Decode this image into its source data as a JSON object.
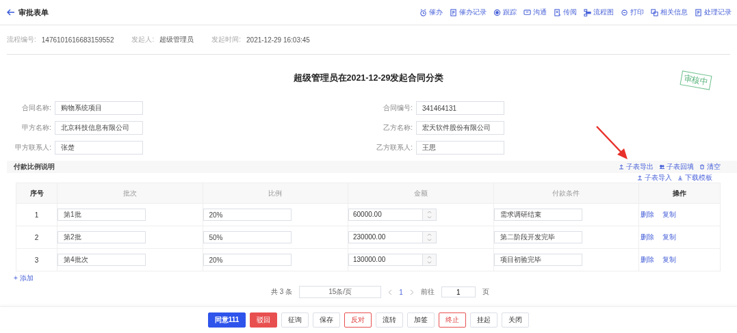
{
  "header": {
    "title": "审批表单",
    "actions": [
      {
        "label": "催办",
        "kind": "clock"
      },
      {
        "label": "催办记录",
        "kind": "doc"
      },
      {
        "label": "跟踪",
        "kind": "target"
      },
      {
        "label": "沟通",
        "kind": "chat"
      },
      {
        "label": "传阅",
        "kind": "list"
      },
      {
        "label": "流程图",
        "kind": "flow"
      },
      {
        "label": "打印",
        "kind": "print"
      },
      {
        "label": "相关信息",
        "kind": "copy"
      },
      {
        "label": "处理记录",
        "kind": "doc"
      }
    ]
  },
  "meta": [
    {
      "label": "流程编号:",
      "value": "1476101616683159552"
    },
    {
      "label": "发起人:",
      "value": "超级管理员"
    },
    {
      "label": "发起时间:",
      "value": "2021-12-29 16:03:45"
    }
  ],
  "form": {
    "title": "超级管理员在2021-12-29发起合同分类",
    "stamp": "审核中",
    "fields": [
      {
        "label": "合同名称:",
        "value": "购物系统项目"
      },
      {
        "label": "合同编号:",
        "value": "341464131"
      },
      {
        "label": "甲方名称:",
        "value": "北京科技信息有限公司"
      },
      {
        "label": "乙方名称:",
        "value": "宏天软件股份有限公司"
      },
      {
        "label": "甲方联系人:",
        "value": "张楚"
      },
      {
        "label": "乙方联系人:",
        "value": "王思"
      }
    ]
  },
  "subtable": {
    "title": "付款比例说明",
    "tools": [
      {
        "label": "子表导出",
        "kind": "export"
      },
      {
        "label": "子表回填",
        "kind": "people"
      },
      {
        "label": "清空",
        "kind": "trash"
      }
    ],
    "tools2": [
      {
        "label": "子表导入",
        "kind": "import"
      },
      {
        "label": "下载模板",
        "kind": "download"
      }
    ],
    "columns": [
      "序号",
      "批次",
      "比例",
      "金额",
      "付款条件",
      "操作"
    ],
    "rows": [
      {
        "index": "1",
        "batch": "第1批",
        "ratio": "20%",
        "amount": "60000.00",
        "condition": "需求调研结束",
        "ops": [
          "删除",
          "复制"
        ]
      },
      {
        "index": "2",
        "batch": "第2批",
        "ratio": "50%",
        "amount": "230000.00",
        "condition": "第二阶段开发完毕",
        "ops": [
          "删除",
          "复制"
        ]
      },
      {
        "index": "3",
        "batch": "第4批次",
        "ratio": "20%",
        "amount": "130000.00",
        "condition": "项目初验完毕",
        "ops": [
          "删除",
          "复制"
        ]
      }
    ],
    "add": "+ 添加",
    "pagination": {
      "total": "共 3 条",
      "size": "15条/页",
      "page": "1",
      "goto": "前往",
      "goto_value": "1",
      "unit": "页"
    }
  },
  "buttons": [
    {
      "label": "同意111",
      "kind": "primary"
    },
    {
      "label": "驳回",
      "kind": "danger"
    },
    {
      "label": "征询",
      "kind": "default"
    },
    {
      "label": "保存",
      "kind": "default"
    },
    {
      "label": "反对",
      "kind": "outline-danger"
    },
    {
      "label": "流转",
      "kind": "default"
    },
    {
      "label": "加签",
      "kind": "default"
    },
    {
      "label": "终止",
      "kind": "outline-danger"
    },
    {
      "label": "挂起",
      "kind": "default"
    },
    {
      "label": "关闭",
      "kind": "default"
    }
  ]
}
